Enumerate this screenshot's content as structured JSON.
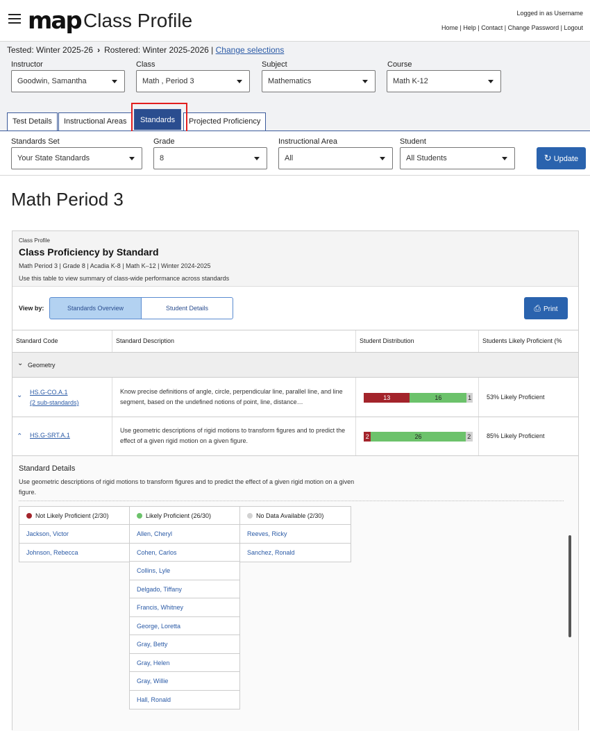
{
  "app": {
    "logo": "map",
    "title": "Class Profile"
  },
  "header": {
    "logged_in": "Logged in as Username",
    "links": [
      "Home",
      "Help",
      "Contact",
      "Change Password",
      "Logout"
    ]
  },
  "selection": {
    "tested": "Tested: Winter 2025-26",
    "rostered": "Rostered: Winter 2025-2026",
    "change_link": "Change selections"
  },
  "filters_top": {
    "instructor": {
      "label": "Instructor",
      "value": "Goodwin, Samantha"
    },
    "class": {
      "label": "Class",
      "value": "Math , Period 3"
    },
    "subject": {
      "label": "Subject",
      "value": "Mathematics"
    },
    "course": {
      "label": "Course",
      "value": "Math K-12"
    }
  },
  "tabs": [
    "Test Details",
    "Instructional Areas",
    "Standards",
    "Projected Proficiency"
  ],
  "active_tab": "Standards",
  "filters_standards": {
    "standards_set": {
      "label": "Standards Set",
      "value": "Your State Standards"
    },
    "grade": {
      "label": "Grade",
      "value": "8"
    },
    "instructional_area": {
      "label": "Instructional Area",
      "value": "All"
    },
    "student": {
      "label": "Student",
      "value": "All Students"
    },
    "update_label": "Update"
  },
  "class_title": "Math Period 3",
  "panel": {
    "supertitle": "Class Profile",
    "title": "Class Proficiency by Standard",
    "meta": "Math Period 3 | Grade 8 | Acadia K-8 | Math K–12 | Winter 2024-2025",
    "description": "Use this table to view summary of class-wide performance across standards",
    "view_by": "View by:",
    "views": [
      "Standards Overview",
      "Student Details"
    ],
    "print_label": "Print",
    "columns": [
      "Standard Code",
      "Standard Description",
      "Student Distribution",
      "Students Likely Proficient (%"
    ],
    "group": "Geometry",
    "rows": [
      {
        "code": "HS.G-CO.A.1",
        "sub": "(2 sub-standards)",
        "description": "Know precise definitions of angle, circle, perpendicular line, parallel line, and line segment, based on the undefined notions of point, line, distance…",
        "not_likely": 13,
        "likely": 16,
        "no_data": 1,
        "likely_text": "53% Likely Proficient"
      },
      {
        "code": "HS.G-SRT.A.1",
        "sub": "",
        "description": "Use geometric descriptions of rigid motions to transform figures and to predict the effect of a given rigid motion on a given figure.",
        "not_likely": 2,
        "likely": 26,
        "no_data": 2,
        "likely_text": "85% Likely Proficient"
      }
    ],
    "details": {
      "title": "Standard Details",
      "text": "Use geometric descriptions of rigid motions to transform figures and to predict the effect of a given rigid motion on a given figure.",
      "not_likely_head": "Not Likely Proficient (2/30)",
      "likely_head": "Likely Proficient (26/30)",
      "no_data_head": "No Data Available (2/30)",
      "not_likely": [
        "Jackson, Victor",
        "Johnson, Rebecca"
      ],
      "likely": [
        "Allen, Cheryl",
        "Cohen, Carlos",
        "Collins, Lyle",
        "Delgado, Tiffany",
        "Francis, Whitney",
        "George, Loretta",
        "Gray, Betty",
        "Gray, Helen",
        "Gray, Willie",
        "Hall, Ronald"
      ],
      "no_data": [
        "Reeves, Ricky",
        "Sanchez, Ronald"
      ]
    }
  },
  "colors": {
    "not_likely": "#a3242b",
    "likely": "#6cc26b",
    "no_data": "#d2d2d2",
    "primary": "#2a63ae",
    "highlight": "#e21e1e"
  }
}
